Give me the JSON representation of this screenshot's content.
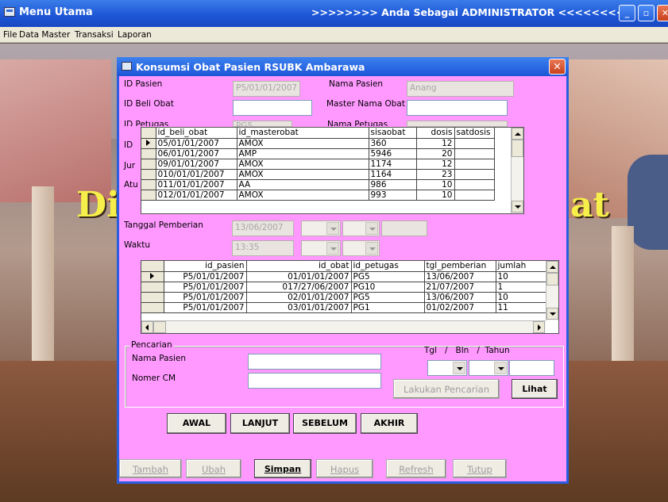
{
  "window": {
    "title": "Menu Utama",
    "admin_banner": ">>>>>>>> Anda Sebagai ADMINISTRATOR <<<<<<<<"
  },
  "menu": [
    "File",
    "Data Master",
    "Transaksi",
    "Laporan"
  ],
  "background": {
    "left_text": "Di",
    "right_text": "at"
  },
  "dialog": {
    "title": "Konsumsi Obat Pasien RSUBK Ambarawa",
    "fields": {
      "id_pasien_label": "ID Pasien",
      "id_pasien_value": "P5/01/01/2007",
      "nama_pasien_label": "Nama Pasien",
      "nama_pasien_value": "Anang",
      "id_beli_obat_label": "ID Beli Obat",
      "id_beli_obat_value": "",
      "master_nama_obat_label": "Master Nama Obat",
      "master_nama_obat_value": "",
      "id_petugas_label": "ID Petugas",
      "id_petugas_value": "PG5",
      "nama_petugas_label": "Nama Petugas",
      "row4_label": "ID",
      "row5_label": "Jur",
      "row6_label": "Atu",
      "tanggal_pemberian_label": "Tanggal Pemberian",
      "tanggal_pemberian_value": "13/06/2007",
      "waktu_label": "Waktu",
      "waktu_value": "13:35"
    },
    "obat_grid": {
      "columns": [
        "id_beli_obat",
        "id_masterobat",
        "sisaobat",
        "dosis",
        "satdosis"
      ],
      "rows": [
        [
          "05/01/01/2007",
          "AMOX",
          "360",
          "12",
          ""
        ],
        [
          "06/01/01/2007",
          "AMP",
          "5946",
          "20",
          ""
        ],
        [
          "09/01/01/2007",
          "AMOX",
          "1174",
          "12",
          ""
        ],
        [
          "010/01/01/2007",
          "AMOX",
          "1164",
          "23",
          ""
        ],
        [
          "011/01/01/2007",
          "AA",
          "986",
          "10",
          ""
        ],
        [
          "012/01/01/2007",
          "AMOX",
          "993",
          "10",
          ""
        ]
      ]
    },
    "konsumsi_grid": {
      "columns": [
        "id_pasien",
        "id_obat",
        "id_petugas",
        "tgl_pemberian",
        "jumlah"
      ],
      "rows": [
        [
          "P5/01/01/2007",
          "01/01/01/2007",
          "PG5",
          "13/06/2007",
          "10"
        ],
        [
          "P5/01/01/2007",
          "017/27/06/2007",
          "PG10",
          "21/07/2007",
          "1"
        ],
        [
          "P5/01/01/2007",
          "02/01/01/2007",
          "PG5",
          "13/06/2007",
          "10"
        ],
        [
          "P5/01/01/2007",
          "03/01/01/2007",
          "PG1",
          "01/02/2007",
          "11"
        ]
      ]
    },
    "search": {
      "legend": "Pencarian",
      "nama_pasien_label": "Nama Pasien",
      "nama_pasien_value": "",
      "nomer_cm_label": "Nomer CM",
      "nomer_cm_value": "",
      "date_header": "Tgl   /   Bln   /  Tahun",
      "search_button": "Lakukan Pencarian",
      "view_button": "Lihat"
    },
    "nav_buttons": {
      "first": "AWAL",
      "next": "LANJUT",
      "prev": "SEBELUM",
      "last": "AKHIR"
    },
    "action_buttons": {
      "add": "Tambah",
      "edit": "Ubah",
      "save": "Simpan",
      "delete": "Hapus",
      "refresh": "Refresh",
      "close": "Tutup"
    }
  }
}
